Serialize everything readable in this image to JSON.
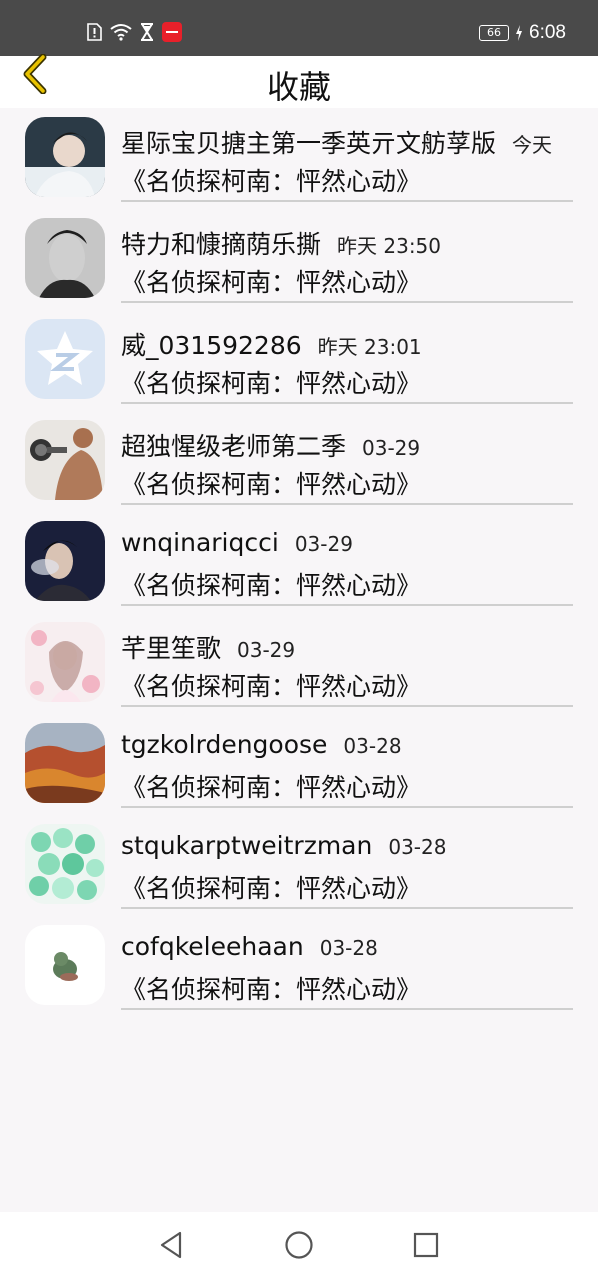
{
  "status_bar": {
    "time": "6:08",
    "battery": "66",
    "icons": [
      "sim-alert-icon",
      "wifi-icon",
      "hourglass-icon",
      "app-notification-icon",
      "charging-icon"
    ]
  },
  "header": {
    "title": "收藏",
    "back_icon": "chevron-left-icon",
    "accent_color": "#e8c200"
  },
  "favorites": [
    {
      "name": "星际宝贝搪主第一季英亓文舫莩版",
      "time": "今天",
      "subtitle": "《名侦探柯南：怦然心动》"
    },
    {
      "name": "特力和慷摘荫乐撕",
      "time": "昨天 23:50",
      "subtitle": "《名侦探柯南：怦然心动》"
    },
    {
      "name": "威_031592286",
      "time": "昨天 23:01",
      "subtitle": "《名侦探柯南：怦然心动》"
    },
    {
      "name": "超独惺级老师第二季",
      "time": "03-29",
      "subtitle": "《名侦探柯南：怦然心动》"
    },
    {
      "name": "wnqinariqcci",
      "time": "03-29",
      "subtitle": "《名侦探柯南：怦然心动》"
    },
    {
      "name": "芊里笙歌",
      "time": "03-29",
      "subtitle": "《名侦探柯南：怦然心动》"
    },
    {
      "name": "tgzkolrdengoose",
      "time": "03-28",
      "subtitle": "《名侦探柯南：怦然心动》"
    },
    {
      "name": "stqukarptweitrzman",
      "time": "03-28",
      "subtitle": "《名侦探柯南：怦然心动》"
    },
    {
      "name": "cofqkeleehaan",
      "time": "03-28",
      "subtitle": "《名侦探柯南：怦然心动》"
    }
  ],
  "nav_bar": {
    "icons": [
      "back-triangle-icon",
      "home-circle-icon",
      "recents-square-icon"
    ]
  }
}
